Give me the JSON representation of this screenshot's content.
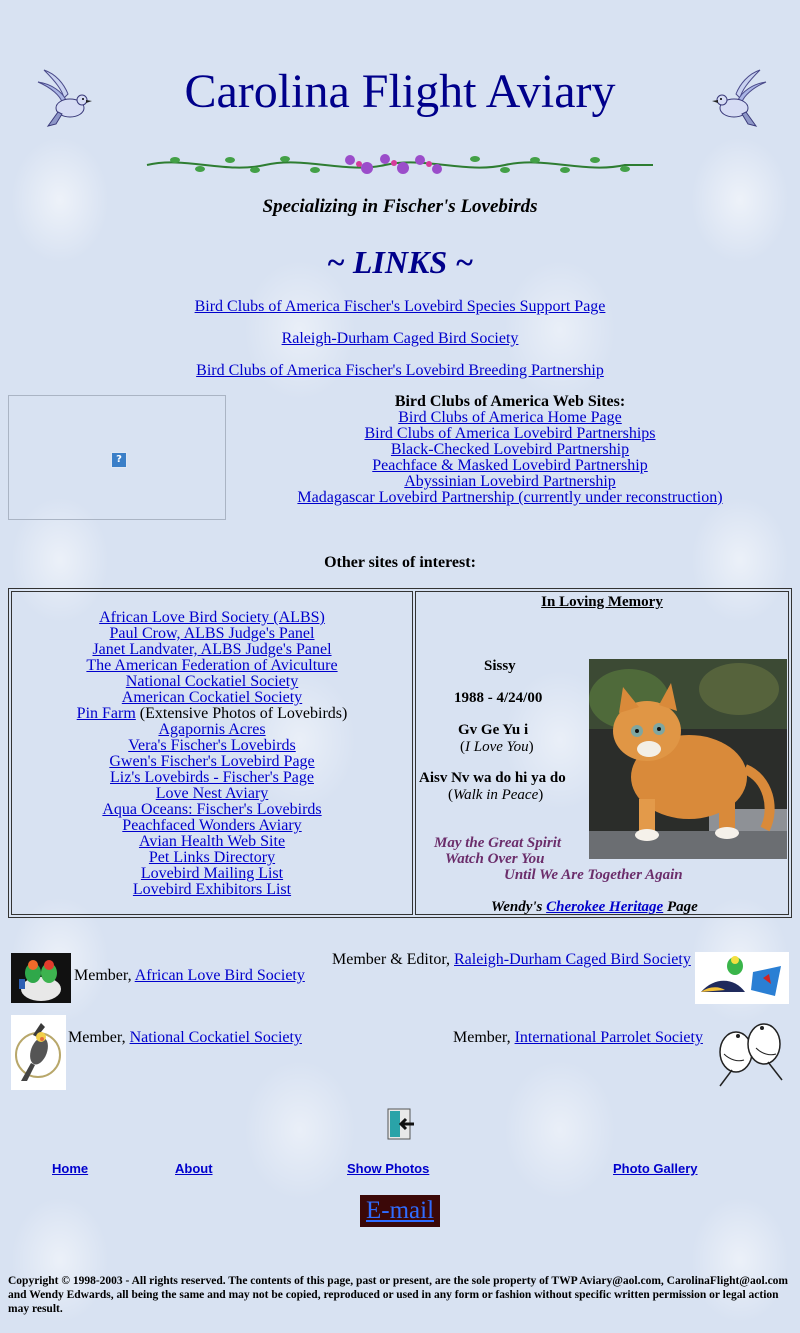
{
  "header": {
    "title": "Carolina Flight Aviary",
    "tagline": "Specializing in Fischer's Lovebirds"
  },
  "links_heading": "~ LINKS ~",
  "top_links": [
    "Bird Clubs of America Fischer's Lovebird Species Support Page",
    "Raleigh-Durham Caged Bird Society",
    "Bird Clubs of America Fischer's Lovebird Breeding Partnership"
  ],
  "broken_image": {
    "icon": "broken-image-icon",
    "glyph": "?"
  },
  "boca": {
    "heading": "Bird Clubs of America Web Sites:",
    "links": [
      "Bird Clubs of America Home Page",
      "Bird Clubs of America Lovebird Partnerships",
      "Black-Checked Lovebird Partnership",
      "Peachface & Masked Lovebird Partnership",
      "Abyssinian Lovebird Partnership",
      "Madagascar Lovebird Partnership (currently under reconstruction)"
    ]
  },
  "other_sites": {
    "heading": "Other sites of interest:",
    "items": [
      {
        "link": "African Love Bird Society (ALBS)",
        "suffix": ""
      },
      {
        "link": "Paul Crow, ALBS Judge's Panel",
        "suffix": ""
      },
      {
        "link": "Janet Landvater, ALBS Judge's Panel",
        "suffix": ""
      },
      {
        "link": "The American Federation of Aviculture",
        "suffix": ""
      },
      {
        "link": "National Cockatiel Society",
        "suffix": ""
      },
      {
        "link": "American Cockatiel Society",
        "suffix": ""
      },
      {
        "link": "Pin Farm",
        "suffix": " (Extensive Photos of Lovebirds)"
      },
      {
        "link": "Agapornis Acres",
        "suffix": ""
      },
      {
        "link": "Vera's Fischer's Lovebirds",
        "suffix": ""
      },
      {
        "link": "Gwen's Fischer's Lovebird Page",
        "suffix": ""
      },
      {
        "link": "Liz's Lovebirds - Fischer's Page",
        "suffix": ""
      },
      {
        "link": "Love Nest Aviary",
        "suffix": ""
      },
      {
        "link": "Aqua Oceans: Fischer's Lovebirds",
        "suffix": ""
      },
      {
        "link": "Peachfaced Wonders Aviary",
        "suffix": ""
      },
      {
        "link": "Avian Health Web Site",
        "suffix": ""
      },
      {
        "link": "Pet Links Directory",
        "suffix": ""
      },
      {
        "link": "Lovebird Mailing List",
        "suffix": ""
      },
      {
        "link": "Lovebird Exhibitors List",
        "suffix": ""
      }
    ]
  },
  "memory": {
    "title": "In Loving Memory",
    "name": "Sissy",
    "dates": "1988 - 4/24/00",
    "line1": "Gv Ge Yu i",
    "line1_translation": "I Love You",
    "line2": "Aisv Nv wa do hi ya do",
    "line2_translation": "Walk in Peace",
    "spirit1": "May the Great Spirit",
    "spirit2": "Watch Over You",
    "spirit3": "Until We Are Together Again",
    "heritage_prefix": "Wendy's",
    "heritage_link": "Cherokee Heritage",
    "heritage_suffix": "Page"
  },
  "memberships": {
    "albs_prefix": "Member,",
    "albs_link": "African Love Bird Society",
    "rdcbs_prefix": "Member & Editor,",
    "rdcbs_link": "Raleigh-Durham Caged Bird Society",
    "ncs_prefix": "Member,",
    "ncs_link": "National Cockatiel Society",
    "ips_prefix": "Member,",
    "ips_link": "International Parrolet Society"
  },
  "nav": {
    "home": "Home",
    "about": "About",
    "show_photos": "Show Photos",
    "photo_gallery": "Photo Gallery",
    "email": "E-mail"
  },
  "copyright": "Copyright © 1998-2003 - All rights reserved.  The contents of this page, past or present, are the sole property of  TWP Aviary@aol.com, CarolinaFlight@aol.com and Wendy Edwards, all being the same and may not be copied, reproduced or used in any form or fashion without specific written permission or legal action may result.",
  "colors": {
    "title": "#00008b",
    "link": "#0000cc",
    "spirit": "#6b2d6b",
    "email_bg": "#3b0808",
    "email_text": "#2f6cff",
    "background": "#d8e2f2"
  }
}
